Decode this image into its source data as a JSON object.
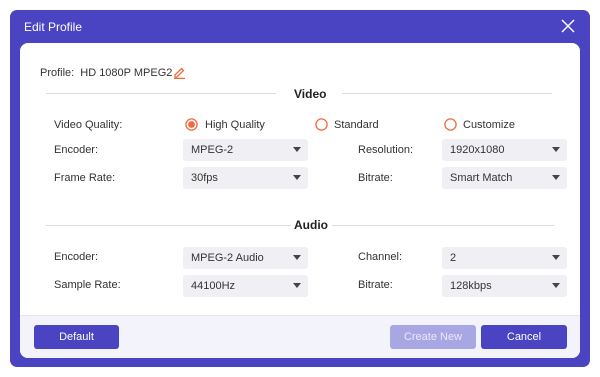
{
  "window": {
    "title": "Edit Profile"
  },
  "profile": {
    "label": "Profile:",
    "value": "HD 1080P MPEG2"
  },
  "video": {
    "section_title": "Video",
    "quality_label": "Video Quality:",
    "quality_options": [
      "High Quality",
      "Standard",
      "Customize"
    ],
    "quality_selected": "High Quality",
    "encoder_label": "Encoder:",
    "encoder_value": "MPEG-2",
    "resolution_label": "Resolution:",
    "resolution_value": "1920x1080",
    "frame_rate_label": "Frame Rate:",
    "frame_rate_value": "30fps",
    "bitrate_label": "Bitrate:",
    "bitrate_value": "Smart Match"
  },
  "audio": {
    "section_title": "Audio",
    "encoder_label": "Encoder:",
    "encoder_value": "MPEG-2 Audio",
    "channel_label": "Channel:",
    "channel_value": "2",
    "sample_rate_label": "Sample Rate:",
    "sample_rate_value": "44100Hz",
    "bitrate_label": "Bitrate:",
    "bitrate_value": "128kbps"
  },
  "buttons": {
    "default": "Default",
    "create_new": "Create New",
    "cancel": "Cancel"
  },
  "colors": {
    "accent": "#4a44c2",
    "radio": "#f06a3c",
    "button_disabled": "#a9a7e3"
  }
}
